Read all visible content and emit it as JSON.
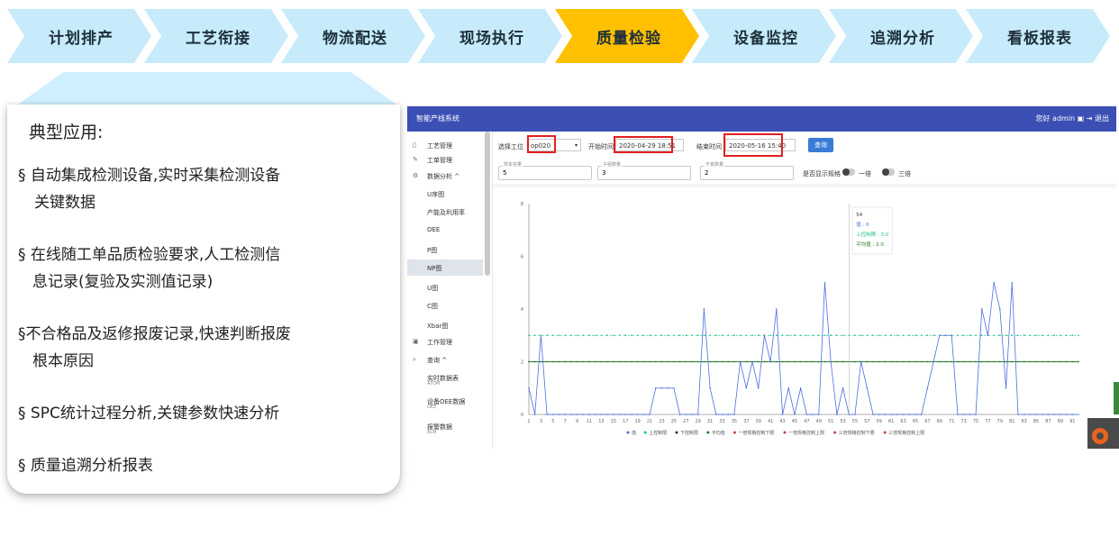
{
  "steps": [
    {
      "label": "计划排产",
      "color": "#c7ebfb"
    },
    {
      "label": "工艺衔接",
      "color": "#c7ebfb"
    },
    {
      "label": "物流配送",
      "color": "#c7ebfb"
    },
    {
      "label": "现场执行",
      "color": "#c7ebfb"
    },
    {
      "label": "质量检验",
      "color": "#ffc000"
    },
    {
      "label": "设备监控",
      "color": "#c7ebfb"
    },
    {
      "label": "追溯分析",
      "color": "#c7ebfb"
    },
    {
      "label": "看板报表",
      "color": "#c7ebfb"
    }
  ],
  "card": {
    "title": "典型应用:",
    "bullets": [
      {
        "line1": "§ 自动集成检测设备,实时采集检测设备",
        "line2": "关键数据"
      },
      {
        "line1": "§ 在线随工单品质检验要求,人工检测信",
        "line2": "息记录(复验及实测值记录)"
      },
      {
        "line1": "§不合格品及返修报废记录,快速判断报废",
        "line2": "根本原因"
      },
      {
        "line1": "§ SPC统计过程分析,关键参数快速分析",
        "line2": ""
      },
      {
        "line1": "§ 质量追溯分析报表",
        "line2": ""
      }
    ]
  },
  "app": {
    "title": "智能产线系统",
    "user": "您好 admin  ▣  ⇥ 退出",
    "sidebar": [
      {
        "icon": "▯",
        "label": "工艺管理",
        "sub": ""
      },
      {
        "icon": "✎",
        "label": "工单管理",
        "sub": ""
      },
      {
        "icon": "⚙",
        "label": "数据分析  ^",
        "sub": ""
      },
      {
        "icon": "",
        "label": "U序图",
        "sub": ""
      },
      {
        "icon": "",
        "label": "产能及利用率",
        "sub": ""
      },
      {
        "icon": "",
        "label": "OEE",
        "sub": ""
      },
      {
        "icon": "",
        "label": "P图",
        "sub": ""
      },
      {
        "icon": "",
        "label": "NP图",
        "sub": ""
      },
      {
        "icon": "",
        "label": "U图",
        "sub": ""
      },
      {
        "icon": "",
        "label": "C图",
        "sub": ""
      },
      {
        "icon": "",
        "label": "Xbar图",
        "sub": ""
      },
      {
        "icon": "▣",
        "label": "工作管理",
        "sub": ""
      },
      {
        "icon": "⌕",
        "label": "查询  ^",
        "sub": ""
      },
      {
        "icon": "",
        "label": "实时数据表",
        "sub": "ATOM"
      },
      {
        "icon": "",
        "label": "设备OEE数据",
        "sub": "OEE"
      },
      {
        "icon": "",
        "label": "报警数据",
        "sub": "ALM"
      }
    ],
    "active_index": 7,
    "filters": {
      "station_label": "选择工位",
      "station_value": "op020",
      "start_label": "开始时间",
      "start_value": "2020-04-29 18:51",
      "end_label": "结束时间",
      "end_value": "2020-05-16 15:40",
      "query_button": "查询",
      "sample_label": "样本容量",
      "sample_value": "5",
      "subgroup_label": "子组数量",
      "subgroup_value": "3",
      "defect_label": "不良数量",
      "defect_value": "2",
      "show_label": "是否显示规格",
      "toggle1_label": "一倍",
      "toggle2_label": "三倍"
    }
  },
  "chart_data": {
    "type": "line",
    "ylim": [
      0,
      8
    ],
    "yticks": [
      0,
      2,
      4,
      6,
      8
    ],
    "x": [
      1,
      2,
      3,
      4,
      5,
      6,
      7,
      8,
      9,
      10,
      11,
      12,
      13,
      14,
      15,
      16,
      17,
      18,
      19,
      20,
      21,
      22,
      23,
      24,
      25,
      26,
      27,
      28,
      29,
      30,
      31,
      32,
      33,
      34,
      35,
      36,
      37,
      38,
      39,
      40,
      41,
      42,
      43,
      44,
      45,
      46,
      47,
      48,
      49,
      50,
      51,
      52,
      53,
      54,
      55,
      56,
      57,
      58,
      59,
      60,
      61,
      62,
      63,
      64,
      65,
      66,
      67,
      68,
      69,
      70,
      71,
      72,
      73,
      74,
      75,
      76,
      77,
      78,
      79,
      80,
      81,
      82,
      83,
      84,
      85,
      86,
      87,
      88,
      89,
      90,
      91,
      92
    ],
    "series": [
      {
        "name": "值",
        "color": "#4a6ee0",
        "values": [
          1,
          0,
          3,
          0,
          0,
          0,
          0,
          0,
          0,
          0,
          0,
          0,
          0,
          0,
          0,
          0,
          0,
          0,
          0,
          0,
          0,
          1,
          1,
          1,
          1,
          0,
          0,
          0,
          0,
          4,
          1,
          0,
          0,
          0,
          0,
          2,
          1,
          2,
          1,
          3,
          2,
          4,
          0,
          1,
          0,
          1,
          0,
          0,
          0,
          5,
          2,
          0,
          1,
          0,
          0,
          2,
          1,
          0,
          0,
          0,
          0,
          0,
          0,
          0,
          0,
          0,
          1,
          2,
          3,
          3,
          3,
          0,
          0,
          0,
          0,
          4,
          3,
          5,
          4,
          1,
          5,
          0,
          0,
          0,
          0,
          0,
          0,
          0,
          0,
          0,
          0,
          0
        ]
      },
      {
        "name": "上控制限",
        "color": "#21c48a",
        "values": [
          3.0
        ]
      },
      {
        "name": "下控制限",
        "color": "#333333",
        "values": [
          0
        ]
      },
      {
        "name": "平均值",
        "color": "#2a7a2a",
        "values": [
          2.0
        ]
      }
    ],
    "legend": [
      "值",
      "上控制限",
      "下控制限",
      "平均值",
      "一倍规格控制下限",
      "一倍规格控制上限",
      "三倍规格控制下限",
      "三倍规格控制上限"
    ],
    "tooltip": {
      "title": "54",
      "line1": "值 : 0",
      "line2": "上控制限 : 3.0",
      "line3": "平均值 : 2.0"
    }
  }
}
